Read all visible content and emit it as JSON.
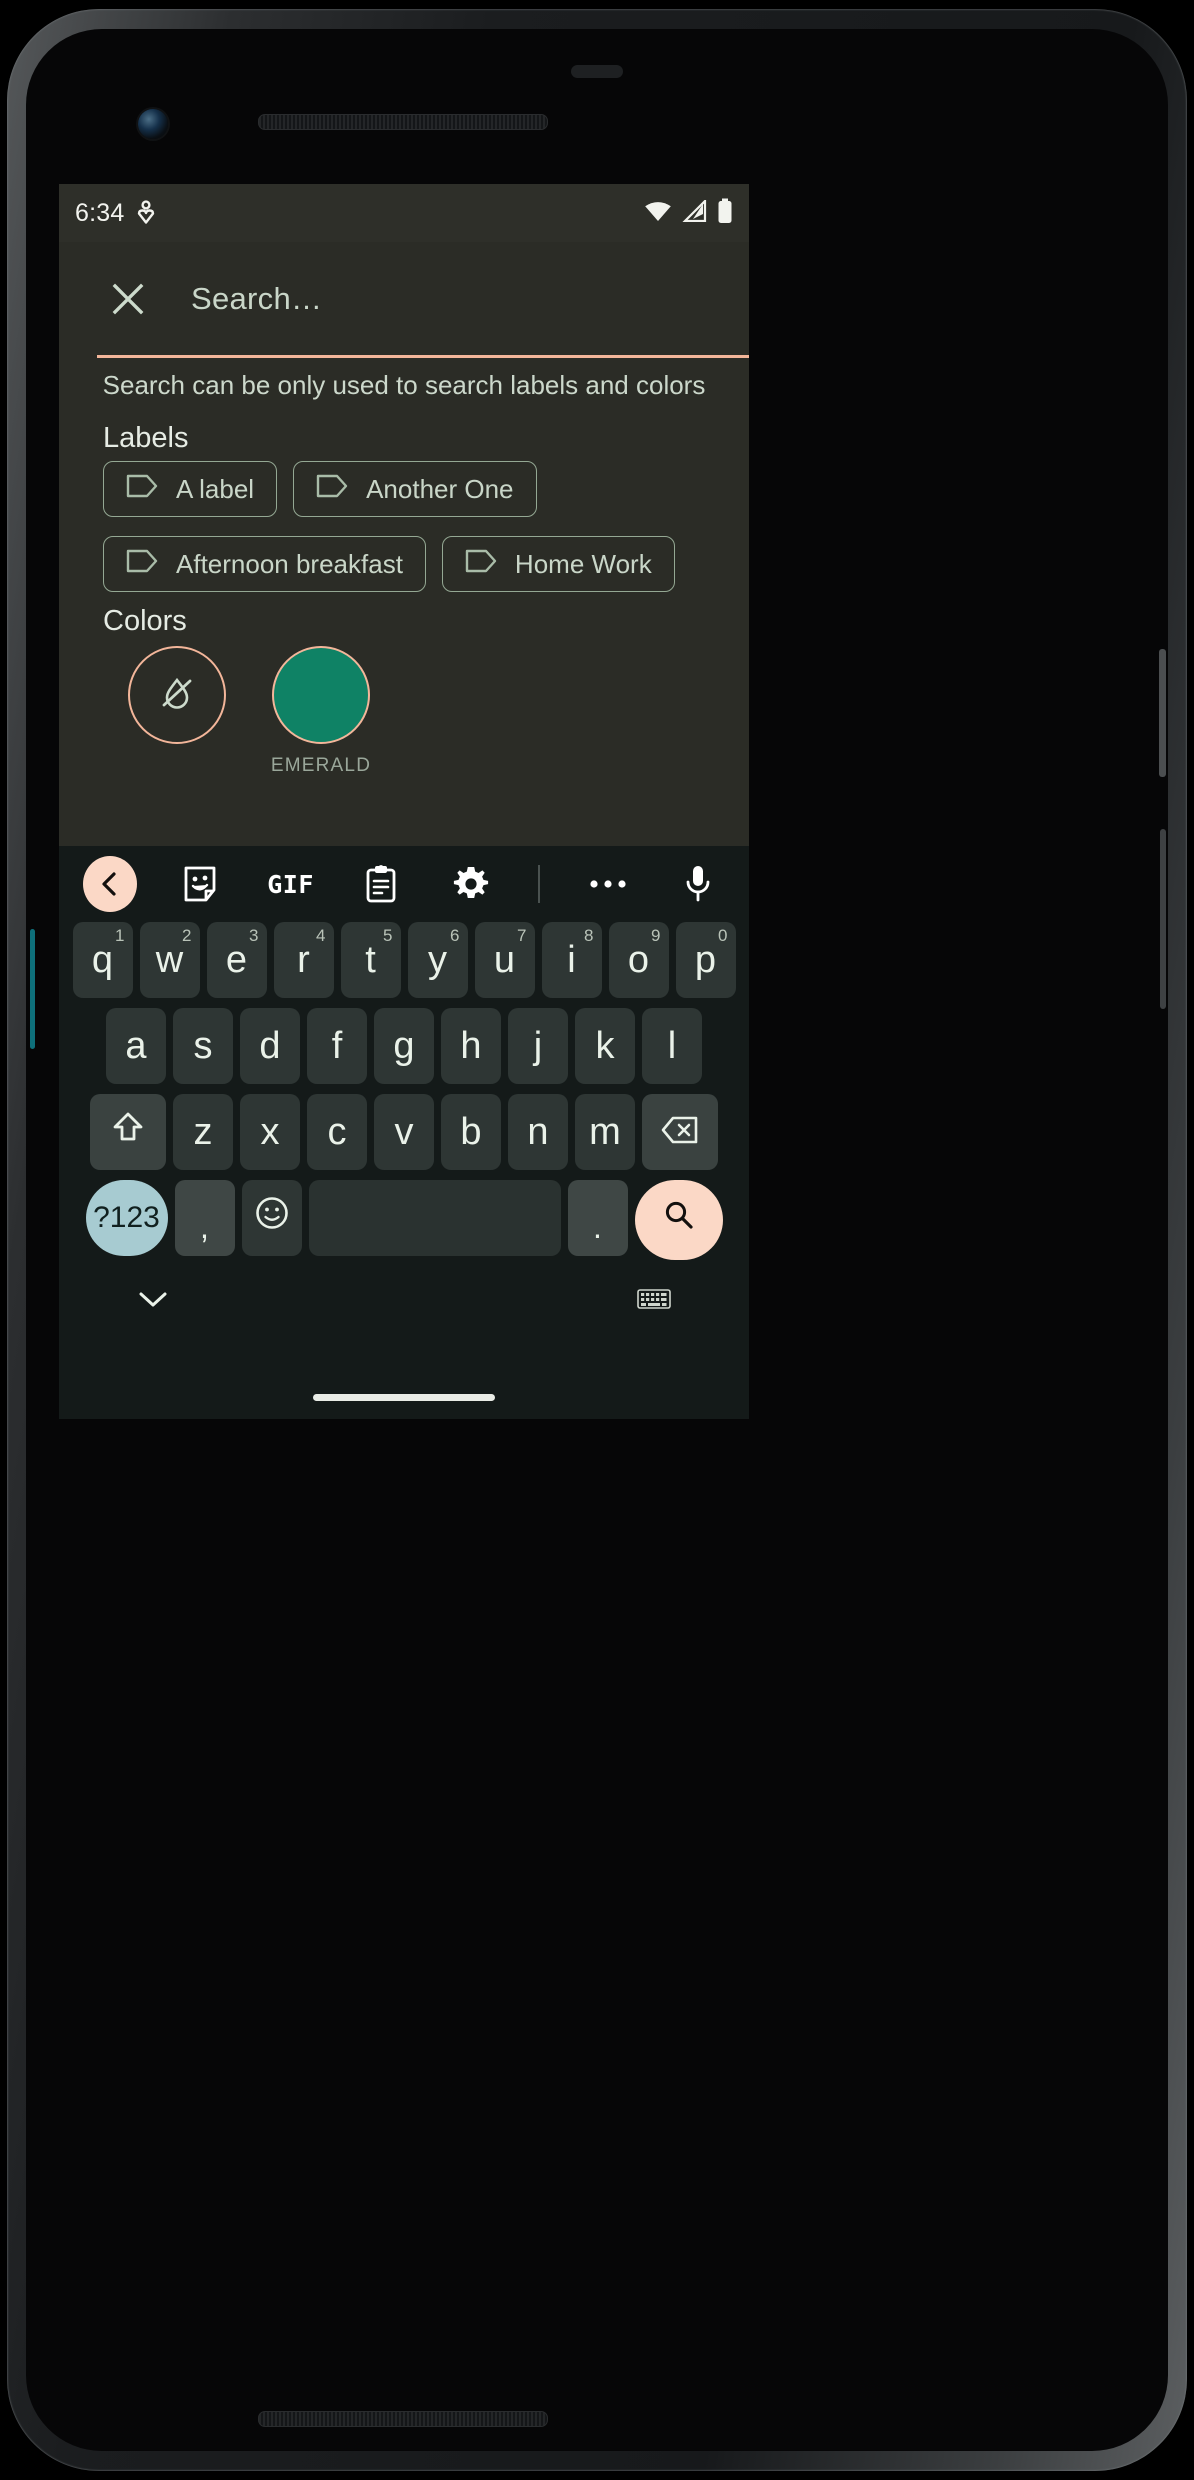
{
  "statusbar": {
    "time": "6:34",
    "left_icon": "location-sharing-icon",
    "right_icons": [
      "wifi-icon",
      "cellular-signal-icon",
      "battery-full-icon"
    ]
  },
  "search": {
    "close_icon": "close-x-icon",
    "placeholder": "Search…",
    "value": "",
    "hint": "Search can be only used to search labels and colors",
    "underline_color": "#f3b69a"
  },
  "labels_section": {
    "title": "Labels",
    "chips": [
      {
        "label": "A label",
        "icon": "tag-icon"
      },
      {
        "label": "Another One",
        "icon": "tag-icon"
      },
      {
        "label": "Afternoon breakfast",
        "icon": "tag-icon"
      },
      {
        "label": "Home Work",
        "icon": "tag-icon"
      }
    ]
  },
  "colors_section": {
    "title": "Colors",
    "swatches": [
      {
        "name": "",
        "icon": "no-color-droplet-icon",
        "fill": "transparent",
        "border": "#f3b69a"
      },
      {
        "name": "EMERALD",
        "icon": "",
        "fill": "#0f8265",
        "border": "#f3b69a"
      }
    ]
  },
  "keyboard": {
    "toolbar": [
      {
        "name": "back-chevron-icon",
        "label": ""
      },
      {
        "name": "sticker-icon",
        "label": ""
      },
      {
        "name": "gif-icon",
        "label": "GIF"
      },
      {
        "name": "clipboard-icon",
        "label": ""
      },
      {
        "name": "settings-gear-icon",
        "label": ""
      },
      {
        "name": "more-options-icon",
        "label": ""
      },
      {
        "name": "microphone-icon",
        "label": ""
      }
    ],
    "row1": [
      {
        "key": "q",
        "sup": "1"
      },
      {
        "key": "w",
        "sup": "2"
      },
      {
        "key": "e",
        "sup": "3"
      },
      {
        "key": "r",
        "sup": "4"
      },
      {
        "key": "t",
        "sup": "5"
      },
      {
        "key": "y",
        "sup": "6"
      },
      {
        "key": "u",
        "sup": "7"
      },
      {
        "key": "i",
        "sup": "8"
      },
      {
        "key": "o",
        "sup": "9"
      },
      {
        "key": "p",
        "sup": "0"
      }
    ],
    "row2": [
      {
        "key": "a"
      },
      {
        "key": "s"
      },
      {
        "key": "d"
      },
      {
        "key": "f"
      },
      {
        "key": "g"
      },
      {
        "key": "h"
      },
      {
        "key": "j"
      },
      {
        "key": "k"
      },
      {
        "key": "l"
      }
    ],
    "row3": [
      {
        "key": "z"
      },
      {
        "key": "x"
      },
      {
        "key": "c"
      },
      {
        "key": "v"
      },
      {
        "key": "b"
      },
      {
        "key": "n"
      },
      {
        "key": "m"
      }
    ],
    "shift_icon": "shift-arrow-icon",
    "backspace_icon": "backspace-icon",
    "symbols_key": "?123",
    "comma_key": ",",
    "emoji_icon": "emoji-smiley-icon",
    "space_key": "",
    "period_key": ".",
    "search_key_icon": "search-magnifier-icon",
    "hide_keyboard_icon": "chevron-down-icon",
    "keyboard_switch_icon": "keyboard-layout-icon",
    "accent_peach": "#fbd8c6",
    "accent_blue": "#a7cbd1"
  }
}
